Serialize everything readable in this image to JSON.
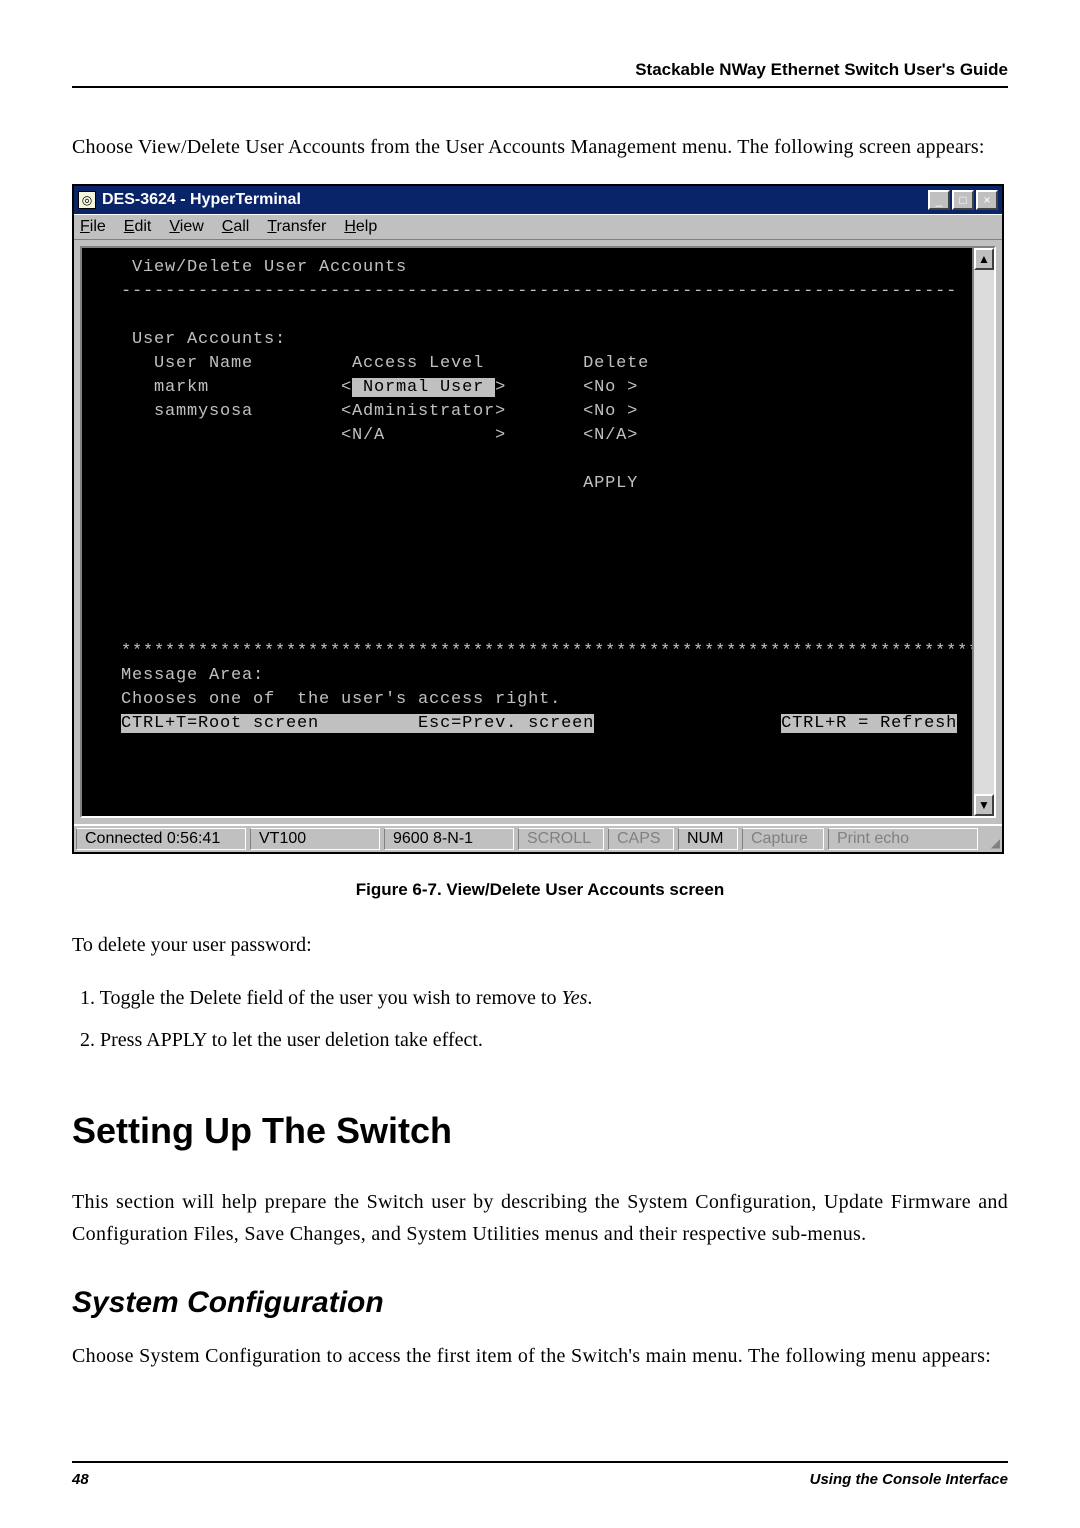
{
  "header": {
    "title": "Stackable NWay Ethernet Switch User's Guide"
  },
  "intro": "Choose View/Delete User Accounts from the User Accounts Management menu. The following screen appears:",
  "window": {
    "title": "DES-3624 - HyperTerminal",
    "menubar": [
      "File",
      "Edit",
      "View",
      "Call",
      "Transfer",
      "Help"
    ]
  },
  "terminal": {
    "line_heading": "    View/Delete User Accounts",
    "divider": "   ----------------------------------------------------------------------------",
    "section": "    User Accounts:",
    "cols": "      User Name         Access Level         Delete",
    "row1_a": "      markm            <",
    "row1_sel": " Normal User ",
    "row1_b": ">       <No >",
    "row2": "      sammysosa        <Administrator>       <No >",
    "row3": "                       <N/A          >       <N/A>",
    "apply": "                                             APPLY",
    "stars": "   ******************************************************************************",
    "msg": "   Message Area:",
    "help": "   Chooses one of  the user's access right.",
    "foot_a": "   ",
    "foot_inv1": "CTRL+T=Root screen         Esc=Prev. screen",
    "foot_mid": "                 ",
    "foot_inv2": "CTRL+R = Refresh"
  },
  "statusbar": {
    "connected": "Connected 0:56:41",
    "emulation": "VT100",
    "settings": "9600 8-N-1",
    "scroll": "SCROLL",
    "caps": "CAPS",
    "num": "NUM",
    "capture": "Capture",
    "printecho": "Print echo"
  },
  "figcap": "Figure 6-7.  View/Delete User Accounts screen",
  "lead_delete": "To delete your user password:",
  "steps": {
    "s1_a": "1.  Toggle the Delete field of the user you wish to remove to ",
    "s1_em": "Yes",
    "s1_b": ".",
    "s2": "2.  Press APPLY to let the user deletion take effect."
  },
  "h1": "Setting Up The Switch",
  "p_setup": "This section will help prepare the Switch user by describing the System Configuration, Update Firmware and Configuration Files, Save Changes, and System Utilities menus and their respective sub-menus.",
  "h2": "System Configuration",
  "p_sysconf": "Choose System Configuration to access the first item of the Switch's main menu. The following menu appears:",
  "footer": {
    "page": "48",
    "section": "Using the Console Interface"
  }
}
